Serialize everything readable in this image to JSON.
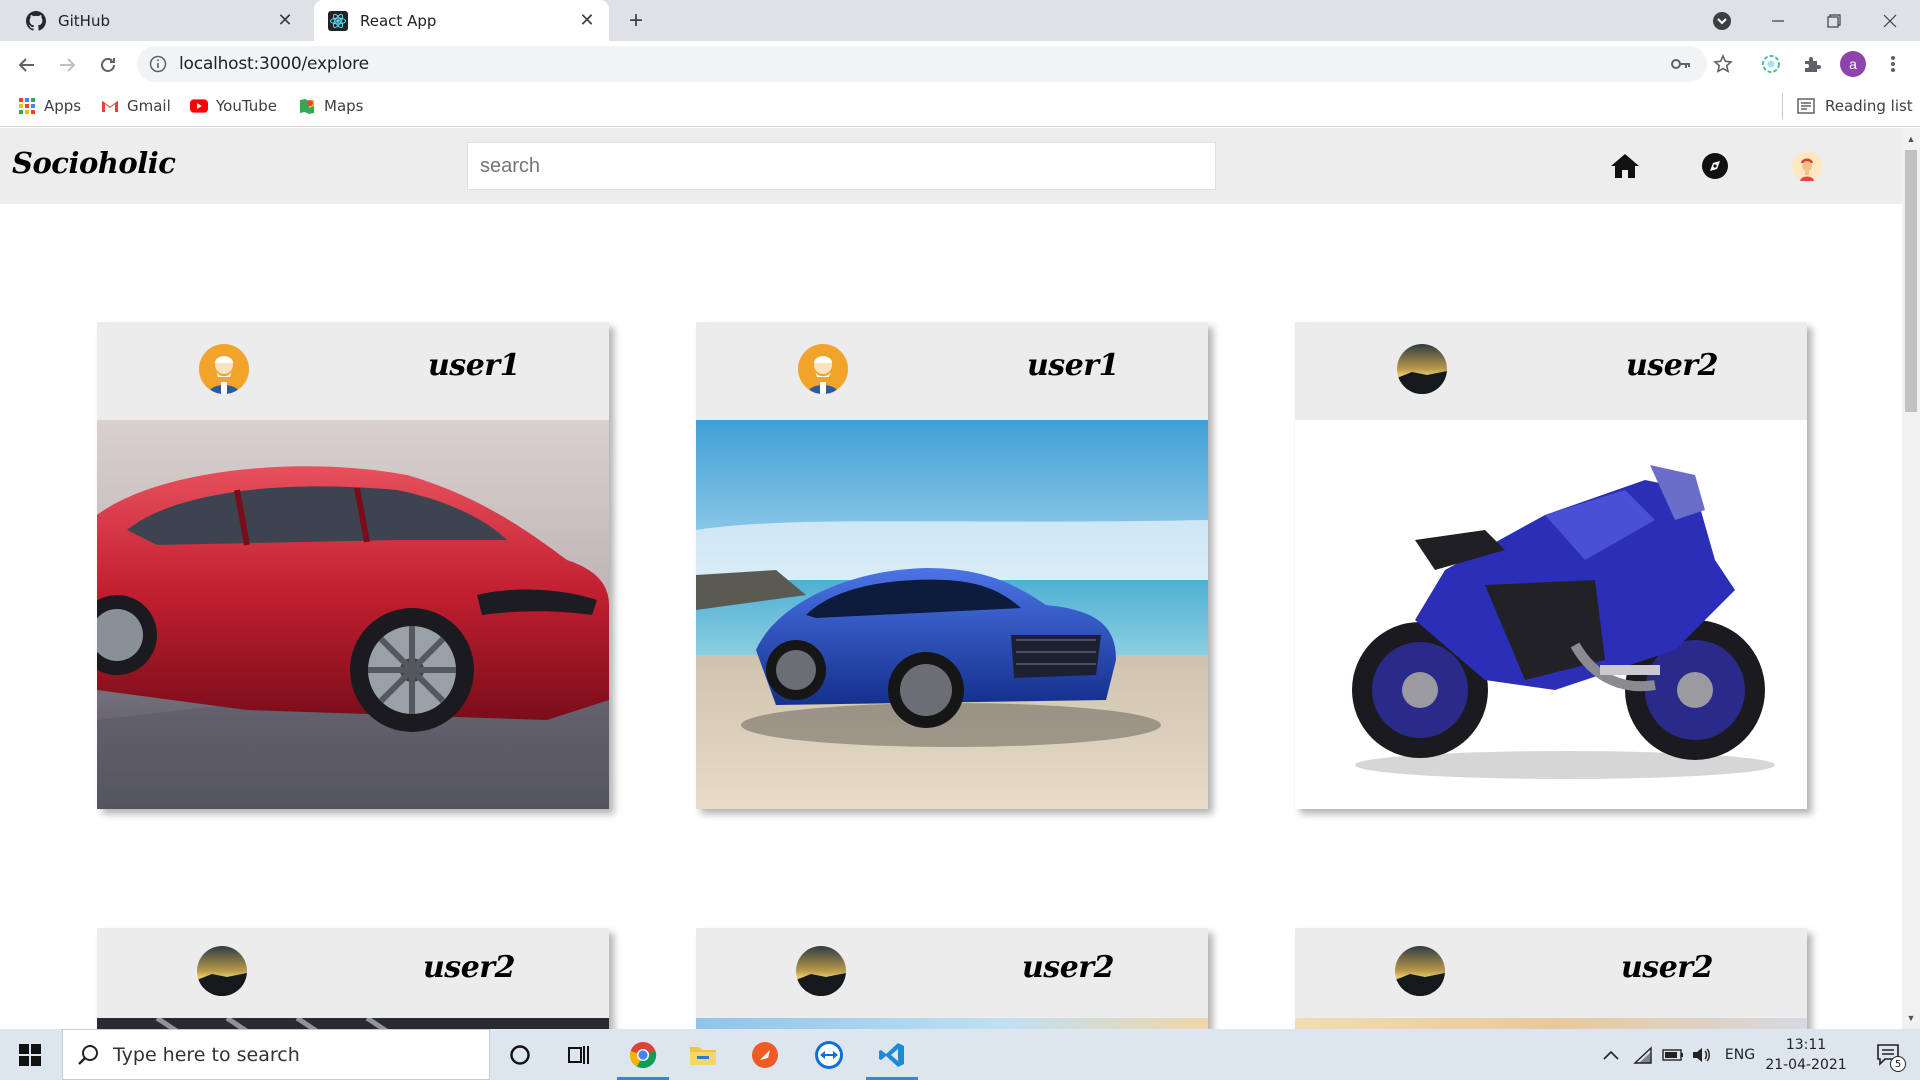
{
  "browser": {
    "tabs": [
      {
        "title": "GitHub",
        "icon": "github-icon",
        "active": false
      },
      {
        "title": "React App",
        "icon": "react-icon",
        "active": true
      }
    ],
    "url": "localhost:3000/explore",
    "bookmarks": [
      {
        "label": "Apps",
        "icon": "apps-grid-icon"
      },
      {
        "label": "Gmail",
        "icon": "gmail-icon"
      },
      {
        "label": "YouTube",
        "icon": "youtube-icon"
      },
      {
        "label": "Maps",
        "icon": "maps-icon"
      }
    ],
    "reading_list": "Reading list",
    "profile_initial": "a"
  },
  "app": {
    "brand": "Socioholic",
    "search_placeholder": "search",
    "nav_icons": [
      "home-icon",
      "explore-compass-icon",
      "profile-avatar-icon"
    ]
  },
  "posts": [
    {
      "user": "user1",
      "image": "red sedan car"
    },
    {
      "user": "user1",
      "image": "blue sedan car on beach"
    },
    {
      "user": "user2",
      "image": "blue sports motorcycle"
    },
    {
      "user": "user2",
      "image": ""
    },
    {
      "user": "user2",
      "image": ""
    },
    {
      "user": "user2",
      "image": ""
    }
  ],
  "taskbar": {
    "search_placeholder": "Type here to search",
    "language": "ENG",
    "time": "13:11",
    "date": "21-04-2021",
    "notifications": "5"
  },
  "colors": {
    "tabstrip": "#dee1e6",
    "appbar": "#ededed",
    "card_header": "#ececec",
    "taskbar": "#dde6ef"
  }
}
